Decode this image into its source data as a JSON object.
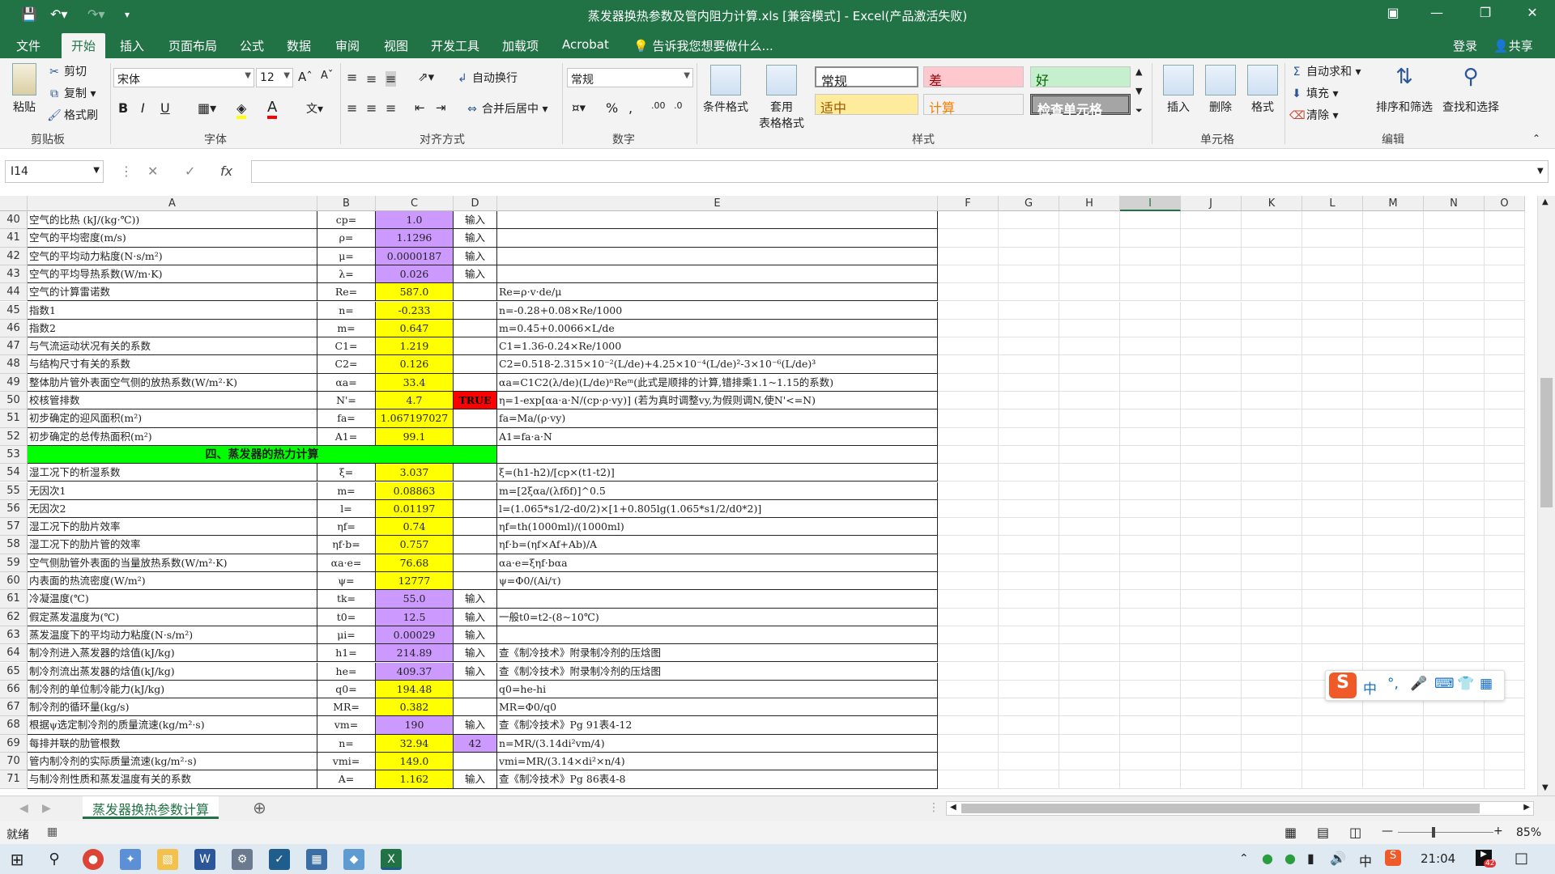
{
  "window": {
    "title": "蒸发器换热参数及管内阻力计算.xls  [兼容模式] - Excel(产品激活失败)",
    "minimize_icon": "minimize-icon",
    "maximize_icon": "restore-icon",
    "close_icon": "close-icon"
  },
  "tabs": [
    "文件",
    "开始",
    "插入",
    "页面布局",
    "公式",
    "数据",
    "审阅",
    "视图",
    "开发工具",
    "加载项",
    "Acrobat"
  ],
  "tell_me": "告诉我您想要做什么...",
  "login": "登录",
  "share": "共享",
  "ribbon": {
    "clipboard": {
      "paste": "粘贴",
      "cut": "剪切",
      "copy": "复制",
      "format_painter": "格式刷",
      "label": "剪贴板"
    },
    "font": {
      "name": "宋体",
      "size": "12",
      "label": "字体",
      "bold": "B",
      "italic": "I",
      "underline": "U"
    },
    "alignment": {
      "wrap": "自动换行",
      "merge": "合并后居中",
      "label": "对齐方式"
    },
    "number": {
      "format": "常规",
      "label": "数字",
      "percent": "%"
    },
    "styles": {
      "conditional": "条件格式",
      "table_format_1": "套用",
      "table_format_2": "表格格式",
      "normal": "常规",
      "bad": "差",
      "good": "好",
      "neutral": "适中",
      "calc": "计算",
      "check": "检查单元格",
      "label": "样式"
    },
    "cells": {
      "insert": "插入",
      "delete": "删除",
      "format": "格式",
      "label": "单元格"
    },
    "editing": {
      "autosum": "自动求和",
      "fill": "填充",
      "clear": "清除",
      "sort": "排序和筛选",
      "find": "查找和选择",
      "label": "编辑"
    }
  },
  "formula_bar": {
    "name_box": "I14",
    "fx": "fx",
    "content": ""
  },
  "columns": [
    "A",
    "B",
    "C",
    "D",
    "E",
    "F",
    "G",
    "H",
    "I",
    "J",
    "K",
    "L",
    "M",
    "N",
    "O"
  ],
  "rows": [
    {
      "n": "40",
      "a": "空气的比热 (kJ/(kg·℃))",
      "b": "cp=",
      "c": "1.0",
      "cc": "purple",
      "d": "输入",
      "e": ""
    },
    {
      "n": "41",
      "a": "空气的平均密度(m/s)",
      "b": "ρ=",
      "c": "1.1296",
      "cc": "purple",
      "d": "输入",
      "e": ""
    },
    {
      "n": "42",
      "a": "空气的平均动力粘度(N·s/m²)",
      "b": "μ=",
      "c": "0.0000187",
      "cc": "purple",
      "d": "输入",
      "e": ""
    },
    {
      "n": "43",
      "a": "空气的平均导热系数(W/m·K)",
      "b": "λ=",
      "c": "0.026",
      "cc": "purple",
      "d": "输入",
      "e": ""
    },
    {
      "n": "44",
      "a": "空气的计算雷诺数",
      "b": "Re=",
      "c": "587.0",
      "cc": "yellow",
      "d": "",
      "e": "Re=ρ·v·de/μ"
    },
    {
      "n": "45",
      "a": "指数1",
      "b": "n=",
      "c": "-0.233",
      "cc": "yellow",
      "d": "",
      "e": "n=-0.28+0.08×Re/1000"
    },
    {
      "n": "46",
      "a": "指数2",
      "b": "m=",
      "c": "0.647",
      "cc": "yellow",
      "d": "",
      "e": "m=0.45+0.0066×L/de"
    },
    {
      "n": "47",
      "a": "与气流运动状况有关的系数",
      "b": "C1=",
      "c": "1.219",
      "cc": "yellow",
      "d": "",
      "e": "C1=1.36-0.24×Re/1000"
    },
    {
      "n": "48",
      "a": "与结构尺寸有关的系数",
      "b": "C2=",
      "c": "0.126",
      "cc": "yellow",
      "d": "",
      "e": "C2=0.518-2.315×10⁻²(L/de)+4.25×10⁻⁴(L/de)²-3×10⁻⁶(L/de)³"
    },
    {
      "n": "49",
      "a": "整体肋片管外表面空气侧的放热系数(W/m²·K)",
      "b": "αa=",
      "c": "33.4",
      "cc": "yellow",
      "d": "",
      "e": "αa=C1C2(λ/de)(L/de)ⁿReᵐ(此式是顺排的计算,错排乘1.1~1.15的系数)"
    },
    {
      "n": "50",
      "a": "校核管排数",
      "b": "N'=",
      "c": "4.7",
      "cc": "yellow",
      "d": "TRUE",
      "dc": "red",
      "e": "η=1-exp[αa·a·N/(cp·ρ·vy)]  (若为真时调整vy,为假则调N,使N'<=N)"
    },
    {
      "n": "51",
      "a": "初步确定的迎风面积(m²)",
      "b": "fa=",
      "c": "1.067197027",
      "cc": "yellow",
      "d": "",
      "e": "fa=Ma/(ρ·vy)"
    },
    {
      "n": "52",
      "a": "初步确定的总传热面积(m²)",
      "b": "A1=",
      "c": "99.1",
      "cc": "yellow",
      "d": "",
      "e": "A1=fa·a·N"
    },
    {
      "n": "53",
      "a": "四、蒸发器的热力计算",
      "section": true,
      "b": "",
      "c": "",
      "d": "",
      "e": ""
    },
    {
      "n": "54",
      "a": "湿工况下的析湿系数",
      "b": "ξ=",
      "c": "3.037",
      "cc": "yellow",
      "d": "",
      "e": "ξ=(h1-h2)/[cp×(t1-t2)]"
    },
    {
      "n": "55",
      "a": "无因次1",
      "b": "m=",
      "c": "0.08863",
      "cc": "yellow",
      "d": "",
      "e": "m=[2ξαa/(λfδf)]^0.5"
    },
    {
      "n": "56",
      "a": "无因次2",
      "b": "l=",
      "c": "0.01197",
      "cc": "yellow",
      "d": "",
      "e": "l=(1.065*s1/2-d0/2)×[1+0.805lg(1.065*s1/2/d0*2)]"
    },
    {
      "n": "57",
      "a": "湿工况下的肋片效率",
      "b": "ηf=",
      "c": "0.74",
      "cc": "yellow",
      "d": "",
      "e": "ηf=th(1000ml)/(1000ml)"
    },
    {
      "n": "58",
      "a": "湿工况下的肋片管的效率",
      "b": "ηf·b=",
      "c": "0.757",
      "cc": "yellow",
      "d": "",
      "e": "ηf·b=(ηf×Af+Ab)/A"
    },
    {
      "n": "59",
      "a": "空气侧肋管外表面的当量放热系数(W/m²·K)",
      "b": "αa·e=",
      "c": "76.68",
      "cc": "yellow",
      "d": "",
      "e": "αa·e=ξηf·bαa"
    },
    {
      "n": "60",
      "a": "内表面的热流密度(W/m²)",
      "b": "ψ=",
      "c": "12777",
      "cc": "yellow",
      "d": "",
      "e": "ψ=Φ0/(Ai/τ)"
    },
    {
      "n": "61",
      "a": "冷凝温度(℃)",
      "b": "tk=",
      "c": "55.0",
      "cc": "purple",
      "d": "输入",
      "e": ""
    },
    {
      "n": "62",
      "a": "假定蒸发温度为(℃)",
      "b": "t0=",
      "c": "12.5",
      "cc": "purple",
      "d": "输入",
      "e": "一般t0=t2-(8~10℃)"
    },
    {
      "n": "63",
      "a": "蒸发温度下的平均动力粘度(N·s/m²)",
      "b": "μi=",
      "c": "0.00029",
      "cc": "purple",
      "d": "输入",
      "e": ""
    },
    {
      "n": "64",
      "a": "制冷剂进入蒸发器的焓值(kJ/kg)",
      "b": "h1=",
      "c": "214.89",
      "cc": "purple",
      "d": "输入",
      "e": "查《制冷技术》附录制冷剂的压焓图"
    },
    {
      "n": "65",
      "a": "制冷剂流出蒸发器的焓值(kJ/kg)",
      "b": "he=",
      "c": "409.37",
      "cc": "purple",
      "d": "输入",
      "e": "查《制冷技术》附录制冷剂的压焓图"
    },
    {
      "n": "66",
      "a": "制冷剂的单位制冷能力(kJ/kg)",
      "b": "q0=",
      "c": "194.48",
      "cc": "yellow",
      "d": "",
      "e": "q0=he-hi"
    },
    {
      "n": "67",
      "a": "制冷剂的循环量(kg/s)",
      "b": "MR=",
      "c": "0.382",
      "cc": "yellow",
      "d": "",
      "e": "MR=Φ0/q0"
    },
    {
      "n": "68",
      "a": "根据ψ选定制冷剂的质量流速(kg/m²·s)",
      "b": "vm=",
      "c": "190",
      "cc": "purple",
      "d": "输入",
      "e": "查《制冷技术》Pg 91表4-12"
    },
    {
      "n": "69",
      "a": "每排并联的肋管根数",
      "b": "n=",
      "c": "32.94",
      "cc": "yellow",
      "d": "42",
      "dc": "purple",
      "e": "n=MR/(3.14di²vm/4)"
    },
    {
      "n": "70",
      "a": "管内制冷剂的实际质量流速(kg/m²·s)",
      "b": "vmi=",
      "c": "149.0",
      "cc": "yellow",
      "d": "",
      "e": "vmi=MR/(3.14×di²×n/4)"
    },
    {
      "n": "71",
      "a": "与制冷剂性质和蒸发温度有关的系数",
      "b": "A=",
      "c": "1.162",
      "cc": "yellow",
      "d": "输入",
      "e": "查《制冷技术》Pg 86表4-8"
    }
  ],
  "sheet_tab": "蒸发器换热参数计算",
  "status": {
    "ready": "就绪",
    "zoom": "85%"
  },
  "taskbar": {
    "time": "21:04",
    "ime_lang": "中",
    "notif_count": "42"
  },
  "colors": {
    "accent": "#217346",
    "input_cell": "#cc99ff",
    "calc_cell": "#ffff00",
    "section": "#00ff00",
    "flag": "#ff0000"
  }
}
